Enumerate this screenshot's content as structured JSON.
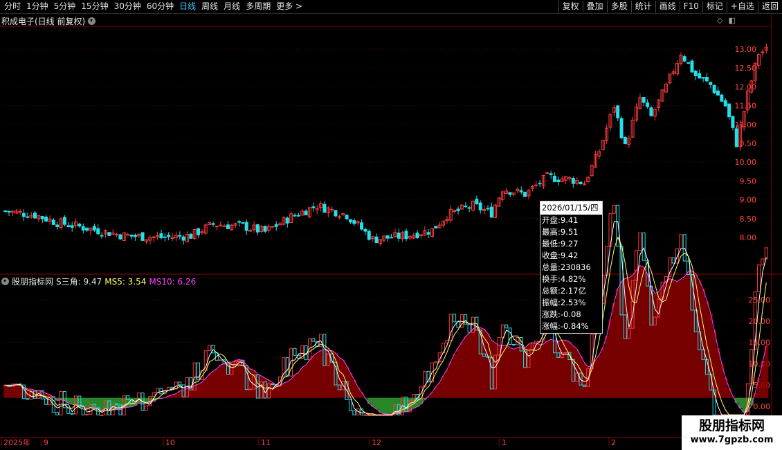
{
  "nav": {
    "tabs": [
      "分时",
      "1分钟",
      "5分钟",
      "15分钟",
      "30分钟",
      "60分钟",
      "日线",
      "周线",
      "月线",
      "多周期",
      "更多 >"
    ],
    "active_index": 6
  },
  "tools": [
    "复权",
    "叠加",
    "多股",
    "统计",
    "画线",
    "F10",
    "标记",
    "+自选",
    "返回"
  ],
  "title": "积成电子(日线 前复权)",
  "indicator": {
    "name": "股朋指标网",
    "s_label": "S三角: 9.47",
    "ms5_label": "MS5: 3.54",
    "ms10_label": "MS10: 6.26"
  },
  "tooltip": {
    "date": "2026/01/15/四",
    "rows": [
      "开盘:9.41",
      "最高:9.51",
      "最低:9.27",
      "收盘:9.42",
      "总量:230836",
      "换手:4.82%",
      "总额:2.17亿",
      "振幅:2.53%",
      "涨跌:-0.08",
      "涨幅:-0.84%"
    ]
  },
  "price_axis": [
    "13.00",
    "12.50",
    "12.00",
    "11.50",
    "11.00",
    "10.50",
    "10.00",
    "9.50",
    "9.00",
    "8.50",
    "8.00"
  ],
  "ind_axis": [
    "25.00",
    "20.00",
    "15.00",
    "10.00",
    "5.00",
    "0.00"
  ],
  "x_axis": [
    "2025年",
    "9",
    "10",
    "11",
    "12",
    "1",
    "2"
  ],
  "watermark": {
    "line1": "股朋指标网",
    "line2": "www.7gpzb.com"
  },
  "colors": {
    "up": "#ff3b3b",
    "down": "#22e0e8",
    "ms5": "#ffff66",
    "ms10": "#ff44ff",
    "s": "#ffffff",
    "area_up": "#8b0000",
    "area_down": "#2e9b2e"
  }
}
